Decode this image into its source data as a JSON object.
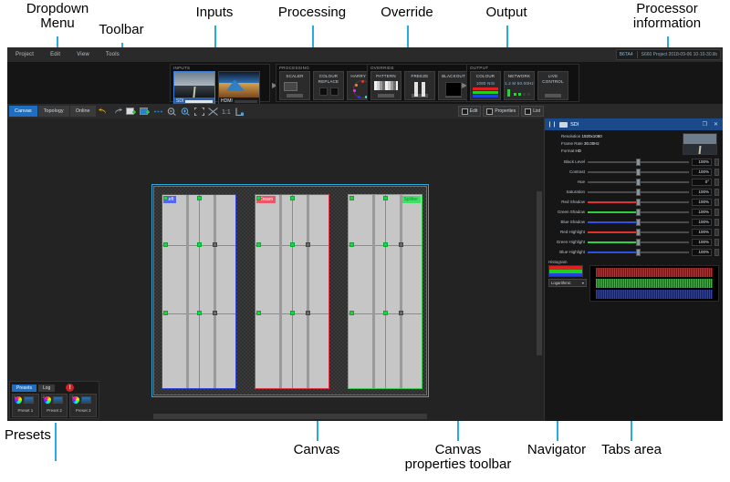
{
  "annotations": [
    {
      "id": "dropdown-menu",
      "text": "Dropdown\nMenu"
    },
    {
      "id": "toolbar",
      "text": "Toolbar"
    },
    {
      "id": "inputs",
      "text": "Inputs"
    },
    {
      "id": "processing",
      "text": "Processing"
    },
    {
      "id": "override",
      "text": "Override"
    },
    {
      "id": "output",
      "text": "Output"
    },
    {
      "id": "processor-information",
      "text": "Processor\ninformation"
    },
    {
      "id": "presets",
      "text": "Presets"
    },
    {
      "id": "canvas",
      "text": "Canvas"
    },
    {
      "id": "canvas-properties-toolbar",
      "text": "Canvas\nproperties toolbar"
    },
    {
      "id": "navigator",
      "text": "Navigator"
    },
    {
      "id": "tabs-area",
      "text": "Tabs area"
    }
  ],
  "app": {
    "menu": {
      "items": [
        "Project",
        "Edit",
        "View",
        "Tools"
      ]
    },
    "processor_info": {
      "device": "B6TA4",
      "project": "S660 Project 2018-09-06 10-10-30.lib"
    },
    "ribbon": {
      "groups": [
        {
          "title": "INPUTS",
          "thumbs": [
            {
              "name": "SDI",
              "selected": true
            },
            {
              "name": "HDMI",
              "selected": false
            }
          ]
        },
        {
          "title": "PROCESSING",
          "tiles": [
            {
              "label": "SCALER"
            },
            {
              "label": "COLOUR\nREPLACE"
            },
            {
              "label": "HARRY OD"
            }
          ]
        },
        {
          "title": "OVERRIDE",
          "tiles": [
            {
              "label": "PATTERN"
            },
            {
              "label": "FREEZE"
            },
            {
              "label": "BLACKOUT"
            }
          ]
        },
        {
          "title": "OUTPUT",
          "tiles": [
            {
              "label": "COLOUR",
              "sub": "1080 NIS"
            },
            {
              "label": "NETWORK",
              "sub": "1.2 M\n50.00Hz"
            },
            {
              "label": "LIVE\nCONTROL",
              "sub": ""
            }
          ]
        }
      ]
    },
    "toolstrip": {
      "tabs": [
        {
          "label": "Canvas",
          "active": true
        },
        {
          "label": "Topology",
          "active": false
        },
        {
          "label": "Online",
          "active": false
        }
      ],
      "icons": [
        "undo-icon",
        "redo-icon",
        "add-screen-icon",
        "add-canvas-icon",
        "link-icon",
        "zoom-out-icon",
        "zoom-in-icon",
        "fit-to-window-icon",
        "fit-selection-icon",
        "actual-size-icon",
        "snap-icon"
      ]
    },
    "canvas_properties_toolbar": {
      "buttons": [
        {
          "label": "Edit",
          "icon": "edit-icon"
        },
        {
          "label": "Properties",
          "icon": "properties-icon"
        },
        {
          "label": "List",
          "icon": "list-icon"
        }
      ]
    },
    "canvas": {
      "screens": [
        {
          "name": "Left",
          "color": "#3344dd"
        },
        {
          "name": "Cream",
          "color": "#dd3344"
        },
        {
          "name": "Splitter",
          "color": "#33cc55"
        }
      ]
    },
    "presets": {
      "tabs": [
        {
          "label": "Presets",
          "active": true
        },
        {
          "label": "Log",
          "active": false
        }
      ],
      "alert_badge": "!",
      "items": [
        {
          "index": "1",
          "name": "Preset 1"
        },
        {
          "index": "2",
          "name": "Preset 2"
        },
        {
          "index": "3",
          "name": "Preset 3"
        }
      ]
    },
    "properties_panel": {
      "title": "SDI",
      "restore_label": "❐",
      "close_label": "✕",
      "info": [
        {
          "label": "Resolution",
          "value": "1920x1080"
        },
        {
          "label": "Frame Rate",
          "value": "30.00Hz"
        },
        {
          "label": "Format",
          "value": "HD"
        }
      ],
      "sliders": [
        {
          "label": "Black Level",
          "value": "100%",
          "fill": "#4a4a4a",
          "pos": 50
        },
        {
          "label": "Contrast",
          "value": "100%",
          "fill": "#4a4a4a",
          "pos": 50
        },
        {
          "label": "Hue",
          "value": "0°",
          "fill": "#4a4a4a",
          "pos": 50
        },
        {
          "label": "Saturation",
          "value": "100%",
          "fill": "#4a4a4a",
          "pos": 50
        },
        {
          "label": "Red Shadow",
          "value": "100%",
          "fill": "#e03030",
          "pos": 50
        },
        {
          "label": "Green Shadow",
          "value": "100%",
          "fill": "#30d040",
          "pos": 50
        },
        {
          "label": "Blue Shadow",
          "value": "100%",
          "fill": "#3050e0",
          "pos": 50
        },
        {
          "label": "Red Highlight",
          "value": "100%",
          "fill": "#e03030",
          "pos": 50
        },
        {
          "label": "Green Highlight",
          "value": "100%",
          "fill": "#30d040",
          "pos": 50
        },
        {
          "label": "Blue Highlight",
          "value": "100%",
          "fill": "#3050e0",
          "pos": 50
        }
      ],
      "histogram": {
        "title": "Histogram",
        "scale_option": "Logarithmic",
        "channels": [
          "#e02020",
          "#20d020",
          "#2040e0"
        ]
      }
    }
  },
  "colors": {
    "accent": "#29ABE2",
    "app_bg": "#1b1b1b",
    "selected_tab": "#1e6fc4"
  }
}
